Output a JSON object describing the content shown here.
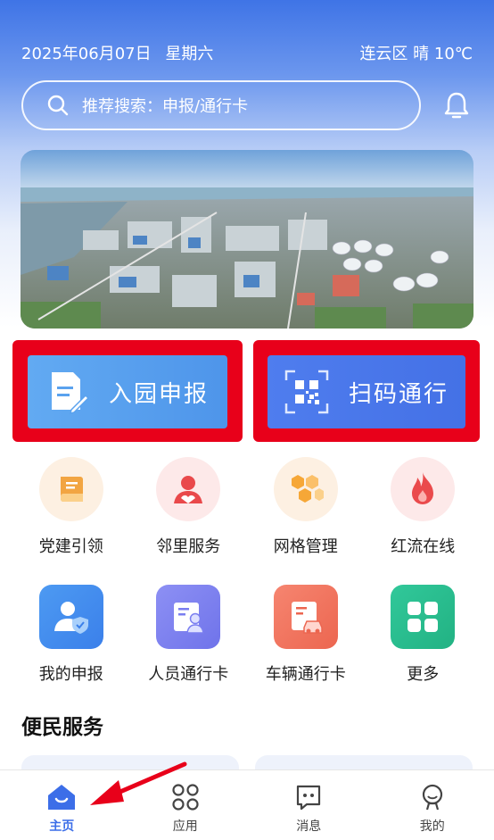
{
  "status": {
    "date": "2025年06月07日",
    "weekday": "星期六",
    "weather": "连云区 晴 10℃"
  },
  "search": {
    "placeholder": "推荐搜索：申报/通行卡",
    "icon": "search-icon"
  },
  "header": {
    "notification_icon": "bell-icon"
  },
  "banner": {
    "description": "industrial-park-aerial-photo"
  },
  "primary_actions": [
    {
      "label": "入园申报",
      "icon": "document-edit-icon",
      "color": "#5aa2ee"
    },
    {
      "label": "扫码通行",
      "icon": "qr-code-icon",
      "color": "#4a78ea"
    }
  ],
  "services_row1": [
    {
      "label": "党建引领",
      "icon": "book-icon"
    },
    {
      "label": "邻里服务",
      "icon": "community-icon"
    },
    {
      "label": "网格管理",
      "icon": "hexagon-grid-icon"
    },
    {
      "label": "红流在线",
      "icon": "flame-icon"
    }
  ],
  "services_row2": [
    {
      "label": "我的申报",
      "icon": "user-shield-icon"
    },
    {
      "label": "人员通行卡",
      "icon": "person-card-icon"
    },
    {
      "label": "车辆通行卡",
      "icon": "vehicle-card-icon"
    },
    {
      "label": "更多",
      "icon": "more-grid-icon"
    }
  ],
  "section": {
    "title": "便民服务"
  },
  "tabbar": {
    "items": [
      {
        "label": "主页",
        "icon": "home-icon",
        "active": true
      },
      {
        "label": "应用",
        "icon": "apps-icon",
        "active": false
      },
      {
        "label": "消息",
        "icon": "message-icon",
        "active": false
      },
      {
        "label": "我的",
        "icon": "profile-icon",
        "active": false
      }
    ]
  },
  "colors": {
    "accent": "#3c6ee8",
    "highlight": "#e8001a"
  }
}
